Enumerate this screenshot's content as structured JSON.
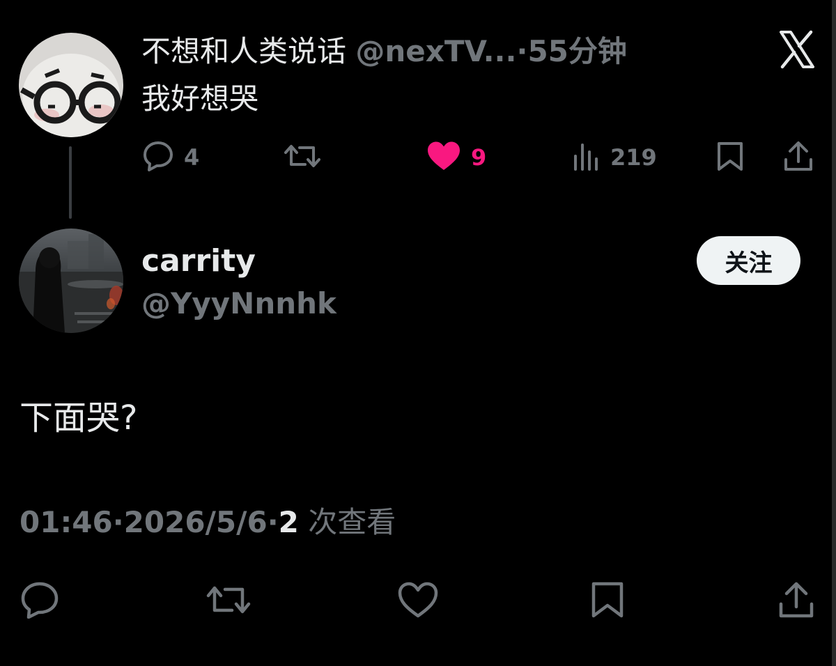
{
  "parent_tweet": {
    "display_name": "不想和人类说话",
    "handle": "@nexTV...",
    "separator": "·",
    "time_ago": "55分钟",
    "text": "我好想哭",
    "stats": {
      "replies": "4",
      "likes": "9",
      "views": "219"
    },
    "liked": true
  },
  "reply_tweet": {
    "display_name": "carrity",
    "handle": "@YyyNnnhk",
    "follow_label": "关注",
    "text": "下面哭?",
    "time": "01:46",
    "separator": "·",
    "date": "2026/5/6",
    "views_count": "2",
    "views_label": "次查看"
  },
  "icons": {
    "reply": "reply-icon",
    "retweet": "retweet-icon",
    "like": "heart-icon",
    "views": "views-icon",
    "bookmark": "bookmark-icon",
    "share": "share-icon",
    "close": "x-logo-icon"
  },
  "colors": {
    "background": "#000000",
    "text_primary": "#e7e9ea",
    "text_muted": "#71767b",
    "like_pink": "#f91880",
    "follow_button_bg": "#eff3f4"
  }
}
